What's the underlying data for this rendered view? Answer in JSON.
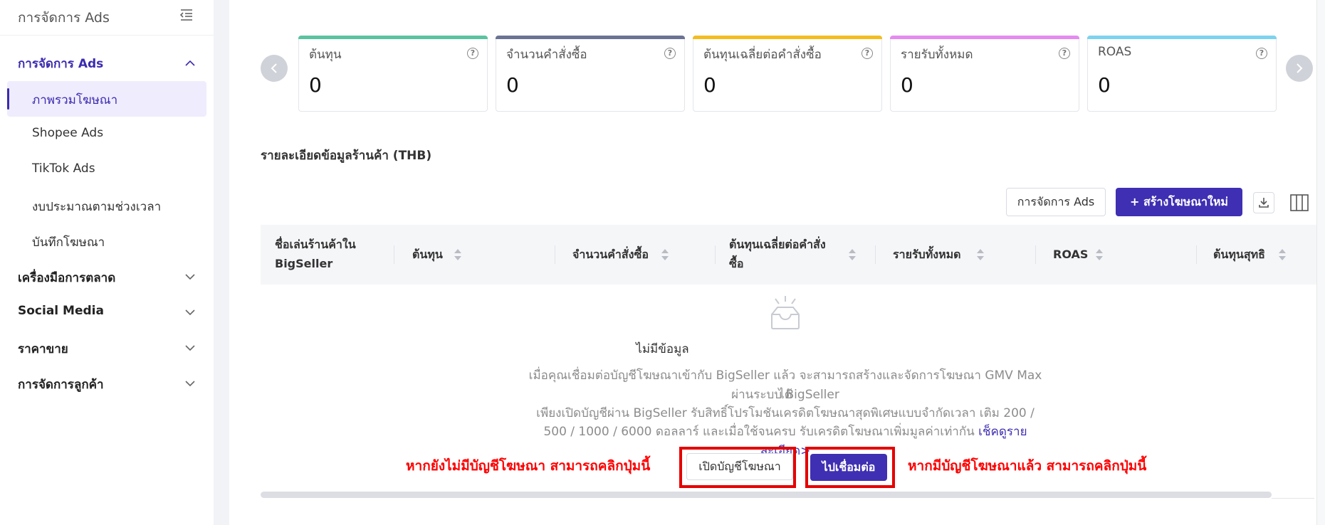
{
  "sidebar": {
    "title": "การจัดการ Ads",
    "collapse_icon": "menu-collapse-icon",
    "section": "การจัดการ Ads",
    "sub_items": [
      {
        "label": "ภาพรวมโฆษณา",
        "active": true
      },
      {
        "label": "Shopee Ads",
        "active": false
      },
      {
        "label": "TikTok Ads",
        "active": false
      },
      {
        "label": "งบประมาณตามช่วงเวลา",
        "active": false
      },
      {
        "label": "บันทึกโฆษณา",
        "active": false
      }
    ],
    "groups": [
      "เครื่องมือการตลาด",
      "Social Media",
      "ราคาขาย",
      "การจัดการลูกค้า"
    ]
  },
  "metrics": [
    {
      "label": "ต้นทุน",
      "value": "0",
      "color": "#5ac3a0"
    },
    {
      "label": "จำนวนคำสั่งซื้อ",
      "value": "0",
      "color": "#6b7394"
    },
    {
      "label": "ต้นทุนเฉลี่ยต่อคำสั่งซื้อ",
      "value": "0",
      "color": "#f3bd1f"
    },
    {
      "label": "รายรับทั้งหมด",
      "value": "0",
      "color": "#e48af0"
    },
    {
      "label": "ROAS",
      "value": "0",
      "color": "#7dd3ef"
    }
  ],
  "section_title": "รายละเอียดข้อมูลร้านค้า (THB)",
  "toolbar": {
    "manage_label": "การจัดการ Ads",
    "create_label": "+ สร้างโฆษณาใหม่",
    "download_icon": "download-icon",
    "columns_icon": "columns-icon"
  },
  "table": {
    "headers": [
      {
        "line1": "ชื่อเล่นร้านค้าใน",
        "line2": "BigSeller"
      },
      {
        "line1": "ต้นทุน",
        "line2": ""
      },
      {
        "line1": "จำนวนคำสั่งซื้อ",
        "line2": ""
      },
      {
        "line1": "ต้นทุนเฉลี่ยต่อคำสั่ง",
        "line2": "ซื้อ"
      },
      {
        "line1": "รายรับทั้งหมด",
        "line2": ""
      },
      {
        "line1": "ROAS",
        "line2": ""
      },
      {
        "line1": "ต้นทุนสุทธิ",
        "line2": ""
      }
    ]
  },
  "empty": {
    "title": "ไม่มีข้อมูล",
    "line1": "เมื่อคุณเชื่อมต่อบัญชีโฆษณาเข้ากับ BigSeller แล้ว จะสามารถสร้างและจัดการโฆษณา GMV Max ได้",
    "line2": "ผ่านระบบ BigSeller",
    "line3": "เพียงเปิดบัญชีผ่าน BigSeller รับสิทธิ์โปรโมชันเครดิตโฆษณาสุดพิเศษแบบจำกัดเวลา เติม 200 /",
    "line4": "500 / 1000 / 6000 ดอลลาร์ และเมื่อใช้จนครบ รับเครดิตโฆษณาเพิ่มมูลค่าเท่ากัน",
    "link": "เช็คดูรายละเอียด>",
    "open_label": "เปิดบัญชีโฆษณา",
    "connect_label": "ไปเชื่อมต่อ"
  },
  "annotations": {
    "left": "หากยังไม่มีบัญชีโฆษณา สามารถคลิกปุ่มนี้",
    "right": "หากมีบัญชีโฆษณาแล้ว สามารถคลิกปุ่มนี้"
  },
  "colors": {
    "accent": "#3f2fb3",
    "annotation_red": "#ff0000"
  }
}
